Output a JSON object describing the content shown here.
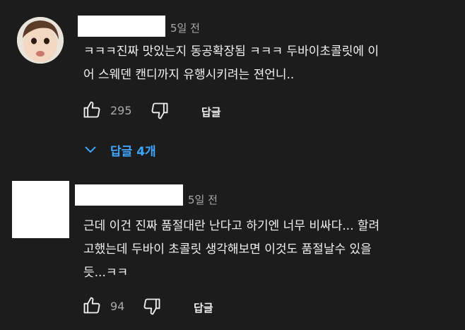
{
  "comments": [
    {
      "time": "5일 전",
      "text": "ㅋㅋㅋ진짜 맛있는지 동공확장됨 ㅋㅋㅋ 두바이초콜릿에 이\n어 스웨덴 캔디까지 유행시키려는 젼언니..",
      "likes": "295",
      "reply_label": "답글",
      "replies_label": "답글 4개"
    },
    {
      "time": "5일 전",
      "text": "근데 이건 진짜 품절대란 난다고 하기엔 너무 비싸다... 할려\n고했는데 두바이 초콜릿 생각해보면 이것도 품절날수 있을\n듯...ㅋㅋ",
      "likes": "94",
      "reply_label": "답글"
    }
  ],
  "colors": {
    "background": "#1c1c1c",
    "accent": "#3ea6ff",
    "muted": "#aaaaaa"
  },
  "icons": [
    "thumbs-up-icon",
    "thumbs-down-icon",
    "chevron-down-icon"
  ]
}
